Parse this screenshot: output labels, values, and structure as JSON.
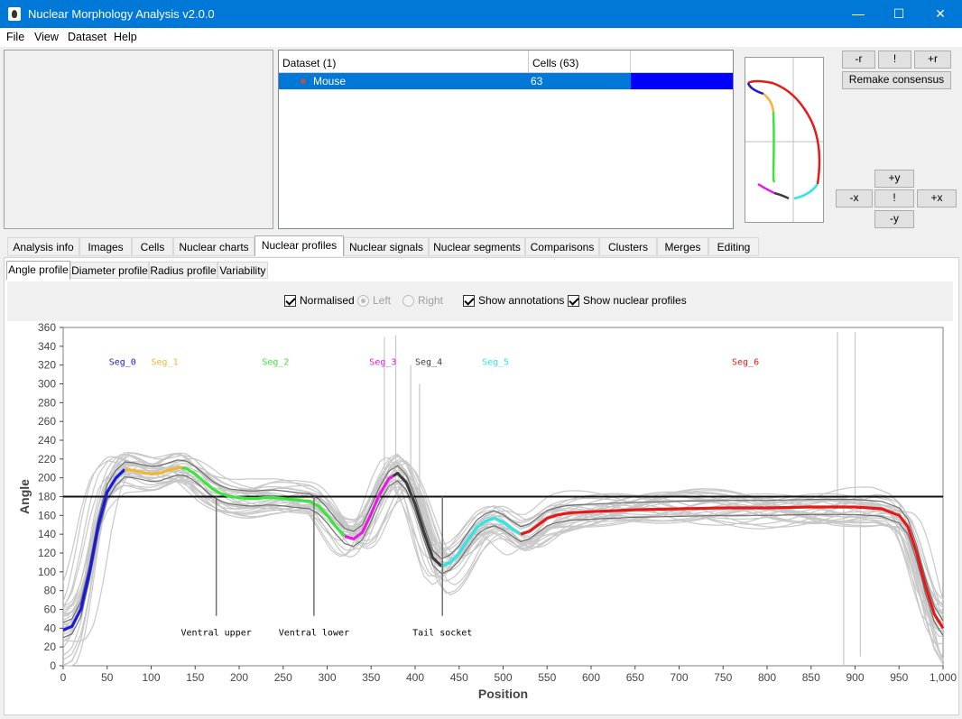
{
  "window": {
    "title": "Nuclear Morphology Analysis v2.0.0",
    "minimize": "—",
    "maximize": "☐",
    "close": "✕"
  },
  "menu": [
    "File",
    "View",
    "Dataset",
    "Help"
  ],
  "dataset_table": {
    "headers": [
      "Dataset (1)",
      "Cells (63)"
    ],
    "rows": [
      {
        "name": "Mouse",
        "cells": "63",
        "colour": "#0000ff"
      }
    ]
  },
  "consensus_controls": {
    "top_buttons": [
      "-r",
      "!",
      "+r"
    ],
    "remake": "Remake consensus",
    "plus_y": "+y",
    "minus_x": "-x",
    "center": "!",
    "plus_x": "+x",
    "minus_y": "-y"
  },
  "tabs": [
    {
      "label": "Analysis info",
      "active": false
    },
    {
      "label": "Images",
      "active": false
    },
    {
      "label": "Cells",
      "active": false
    },
    {
      "label": "Nuclear charts",
      "active": false
    },
    {
      "label": "Nuclear profiles",
      "active": true
    },
    {
      "label": "Nuclear signals",
      "active": false
    },
    {
      "label": "Nuclear segments",
      "active": false
    },
    {
      "label": "Comparisons",
      "active": false
    },
    {
      "label": "Clusters",
      "active": false
    },
    {
      "label": "Merges",
      "active": false
    },
    {
      "label": "Editing",
      "active": false
    }
  ],
  "subtabs": [
    {
      "label": "Angle profile",
      "active": true
    },
    {
      "label": "Diameter profile",
      "active": false
    },
    {
      "label": "Radius profile",
      "active": false
    },
    {
      "label": "Variability",
      "active": false
    }
  ],
  "options": {
    "normalised": {
      "label": "Normalised",
      "checked": true
    },
    "left": {
      "label": "Left",
      "checked": true,
      "enabled": false
    },
    "right": {
      "label": "Right",
      "checked": false,
      "enabled": false
    },
    "show_annotations": {
      "label": "Show annotations",
      "checked": true
    },
    "show_nuclear_profiles": {
      "label": "Show nuclear profiles",
      "checked": true
    }
  },
  "chart_data": {
    "type": "line",
    "xlabel": "Position",
    "ylabel": "Angle",
    "xlim": [
      0,
      1000
    ],
    "ylim": [
      0,
      360
    ],
    "x_ticks": [
      "0",
      "50",
      "100",
      "150",
      "200",
      "250",
      "300",
      "350",
      "400",
      "450",
      "500",
      "550",
      "600",
      "650",
      "700",
      "750",
      "800",
      "850",
      "900",
      "950",
      "1,000"
    ],
    "y_ticks": [
      "0",
      "20",
      "40",
      "60",
      "80",
      "100",
      "120",
      "140",
      "160",
      "180",
      "200",
      "220",
      "240",
      "260",
      "280",
      "300",
      "320",
      "340",
      "360"
    ],
    "reference_line": 180,
    "median_profile": [
      [
        0,
        38
      ],
      [
        10,
        42
      ],
      [
        20,
        60
      ],
      [
        30,
        100
      ],
      [
        40,
        150
      ],
      [
        50,
        185
      ],
      [
        60,
        200
      ],
      [
        70,
        209
      ],
      [
        80,
        208
      ],
      [
        90,
        206
      ],
      [
        100,
        204
      ],
      [
        110,
        205
      ],
      [
        120,
        208
      ],
      [
        130,
        211
      ],
      [
        140,
        210
      ],
      [
        150,
        204
      ],
      [
        160,
        196
      ],
      [
        170,
        188
      ],
      [
        180,
        183
      ],
      [
        190,
        180
      ],
      [
        200,
        179
      ],
      [
        210,
        178
      ],
      [
        220,
        178
      ],
      [
        230,
        179
      ],
      [
        240,
        179
      ],
      [
        250,
        178
      ],
      [
        260,
        177
      ],
      [
        270,
        176
      ],
      [
        280,
        175
      ],
      [
        290,
        170
      ],
      [
        300,
        160
      ],
      [
        310,
        148
      ],
      [
        320,
        138
      ],
      [
        330,
        135
      ],
      [
        340,
        142
      ],
      [
        350,
        162
      ],
      [
        360,
        183
      ],
      [
        370,
        199
      ],
      [
        380,
        205
      ],
      [
        390,
        195
      ],
      [
        400,
        172
      ],
      [
        410,
        142
      ],
      [
        420,
        115
      ],
      [
        430,
        106
      ],
      [
        440,
        110
      ],
      [
        450,
        120
      ],
      [
        460,
        134
      ],
      [
        470,
        147
      ],
      [
        480,
        154
      ],
      [
        490,
        157
      ],
      [
        500,
        153
      ],
      [
        510,
        146
      ],
      [
        520,
        140
      ],
      [
        530,
        143
      ],
      [
        540,
        150
      ],
      [
        550,
        157
      ],
      [
        560,
        160
      ],
      [
        570,
        162
      ],
      [
        580,
        163
      ],
      [
        600,
        164
      ],
      [
        650,
        166
      ],
      [
        700,
        167
      ],
      [
        750,
        168
      ],
      [
        800,
        168
      ],
      [
        850,
        169
      ],
      [
        900,
        169
      ],
      [
        930,
        167
      ],
      [
        950,
        160
      ],
      [
        960,
        148
      ],
      [
        970,
        120
      ],
      [
        980,
        85
      ],
      [
        990,
        55
      ],
      [
        1000,
        40
      ]
    ],
    "segments": [
      {
        "name": "Seg_0",
        "color": "#1a1ad9",
        "start": 0,
        "end": 70
      },
      {
        "name": "Seg_1",
        "color": "#f2b630",
        "start": 70,
        "end": 135
      },
      {
        "name": "Seg_2",
        "color": "#39e639",
        "start": 135,
        "end": 320
      },
      {
        "name": "Seg_3",
        "color": "#e619e6",
        "start": 320,
        "end": 375
      },
      {
        "name": "Seg_4",
        "color": "#3c3c3c",
        "start": 375,
        "end": 430
      },
      {
        "name": "Seg_5",
        "color": "#2ee6e6",
        "start": 430,
        "end": 520
      },
      {
        "name": "Seg_6",
        "color": "#e61919",
        "start": 520,
        "end": 1000
      }
    ],
    "segment_label_positions": [
      52,
      100,
      226,
      348,
      400,
      476,
      760
    ],
    "annotations": [
      {
        "label": "Ventral upper",
        "x": 174
      },
      {
        "label": "Ventral lower",
        "x": 285
      },
      {
        "label": "Tail socket",
        "x": 431
      }
    ]
  }
}
